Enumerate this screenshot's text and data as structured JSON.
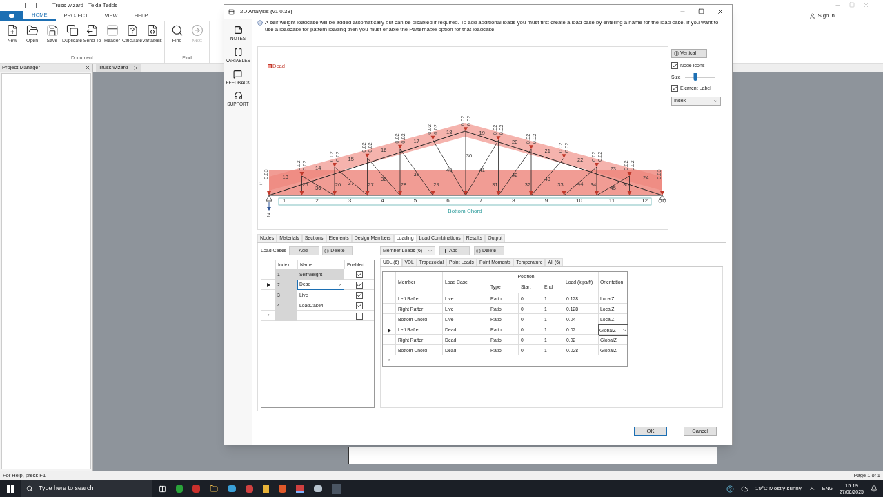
{
  "app": {
    "title": "Truss wizard - Tekla Tedds",
    "sign_in": "Sign in",
    "ribbon_tabs": [
      {
        "label": "HOME",
        "selected": true
      },
      {
        "label": "PROJECT",
        "selected": false
      },
      {
        "label": "VIEW",
        "selected": false
      },
      {
        "label": "HELP",
        "selected": false
      }
    ],
    "ribbon_groups": [
      {
        "label": "Document",
        "buttons": [
          {
            "label": "New",
            "disabled": false
          },
          {
            "label": "Open",
            "disabled": false
          },
          {
            "label": "Save",
            "disabled": false
          },
          {
            "label": "Duplicate",
            "disabled": false
          },
          {
            "label": "Send To",
            "disabled": false
          },
          {
            "label": "Header",
            "disabled": false
          },
          {
            "label": "Calculate",
            "disabled": false
          },
          {
            "label": "Variables",
            "disabled": false
          }
        ]
      },
      {
        "label": "Find",
        "buttons": [
          {
            "label": "Find",
            "disabled": false
          },
          {
            "label": "Next",
            "disabled": true
          }
        ]
      }
    ],
    "project_manager": "Project Manager",
    "document_tab": "Truss wizard",
    "status": "For Help, press F1",
    "page": "Page 1 of 1"
  },
  "dialog": {
    "title": "2D Analysis (v1.0.38)",
    "sidebar": [
      "NOTES",
      "VARIABLES",
      "FEEDBACK",
      "SUPPORT"
    ],
    "info": "A self-weight loadcase will be added automatically but can be disabled if required. To add additional loads you must first create a load case by entering a name for the load case. If you want to use a loadcase for pattern loading then you must enable the Patternable option for that loadcase.",
    "diagram": {
      "legend": "Dead",
      "support_node": "1",
      "axis": "Z",
      "bottom_chord_label": "Bottom Chord",
      "bottom_members": [
        "1",
        "2",
        "3",
        "4",
        "5",
        "6",
        "7",
        "8",
        "9",
        "10",
        "11",
        "12"
      ],
      "top_members": [
        "13",
        "14",
        "15",
        "16",
        "17",
        "18",
        "19",
        "20",
        "21",
        "22",
        "23",
        "24"
      ],
      "verticals": [
        "25",
        "26",
        "27",
        "28",
        "29",
        "30",
        "31",
        "32",
        "33",
        "34",
        "35"
      ],
      "diagonals": [
        "36",
        "37",
        "38",
        "39",
        "40",
        "41",
        "42",
        "43",
        "44",
        "45"
      ],
      "node_loads": [
        [
          "0.03"
        ],
        [
          "0.02",
          "0.02"
        ],
        [
          "0.02",
          "0.02"
        ],
        [
          "0.02",
          "0.02"
        ],
        [
          "0.02",
          "0.02"
        ],
        [
          "0.02",
          "0.02"
        ],
        [
          "0.02",
          "0.02"
        ],
        [
          "0.02",
          "0.02"
        ],
        [
          "0.02",
          "0.02"
        ],
        [
          "0.02",
          "0.02"
        ],
        [
          "0.02",
          "0.02"
        ],
        [
          "0.02",
          "0.02"
        ],
        [
          "0.03"
        ]
      ]
    },
    "options": {
      "vertical": "Vertical",
      "node_icons": {
        "label": "Node Icons",
        "checked": true
      },
      "size": {
        "label": "Size",
        "level": 0.35
      },
      "element_label": {
        "label": "Element Label",
        "checked": true
      },
      "label_type": "Index"
    },
    "tabs": [
      {
        "label": "Nodes",
        "selected": false
      },
      {
        "label": "Materials",
        "selected": false
      },
      {
        "label": "Sections",
        "selected": false
      },
      {
        "label": "Elements",
        "selected": false
      },
      {
        "label": "Design Members",
        "selected": false
      },
      {
        "label": "Loading",
        "selected": true
      },
      {
        "label": "Load Combinations",
        "selected": false
      },
      {
        "label": "Results",
        "selected": false
      },
      {
        "label": "Output",
        "selected": false
      }
    ],
    "load_cases": {
      "label": "Load Cases",
      "add": "Add",
      "delete": "Delete",
      "columns": [
        "Index",
        "Name",
        "Enabled"
      ],
      "new_row": {
        "marker": "*",
        "enabled": false
      },
      "rows": [
        {
          "index": "1",
          "name": "Self weight",
          "enabled": true,
          "current": false
        },
        {
          "index": "2",
          "name": "Dead",
          "enabled": true,
          "current": true
        },
        {
          "index": "3",
          "name": "Live",
          "enabled": true,
          "current": false
        },
        {
          "index": "4",
          "name": "LoadCase4",
          "enabled": true,
          "current": false
        }
      ]
    },
    "member_loads": {
      "selector": "Member Loads (6)",
      "add": "Add",
      "delete": "Delete",
      "tabs": [
        {
          "label": "UDL (6)",
          "selected": true
        },
        {
          "label": "VDL",
          "selected": false
        },
        {
          "label": "Trapezoidal",
          "selected": false
        },
        {
          "label": "Point Loads",
          "selected": false
        },
        {
          "label": "Point Moments",
          "selected": false
        },
        {
          "label": "Temperature",
          "selected": false
        },
        {
          "label": "All (6)",
          "selected": false
        }
      ],
      "columns": {
        "member": "Member",
        "load_case": "Load Case",
        "position": "Position",
        "type": "Type",
        "start": "Start",
        "end": "End",
        "load": "Load (kips/ft)",
        "orientation": "Orientation"
      },
      "new_row": "*",
      "rows": [
        {
          "member": "Left Rafter",
          "load_case": "Live",
          "type": "Ratio",
          "start": "0",
          "end": "1",
          "load": "0.128",
          "orientation": "LocalZ",
          "current": false
        },
        {
          "member": "Right Rafter",
          "load_case": "Live",
          "type": "Ratio",
          "start": "0",
          "end": "1",
          "load": "0.128",
          "orientation": "LocalZ",
          "current": false
        },
        {
          "member": "Bottom Chord",
          "load_case": "Live",
          "type": "Ratio",
          "start": "0",
          "end": "1",
          "load": "0.04",
          "orientation": "LocalZ",
          "current": false
        },
        {
          "member": "Left Rafter",
          "load_case": "Dead",
          "type": "Ratio",
          "start": "0",
          "end": "1",
          "load": "0.02",
          "orientation": "GlobalZ",
          "current": true
        },
        {
          "member": "Right Rafter",
          "load_case": "Dead",
          "type": "Ratio",
          "start": "0",
          "end": "1",
          "load": "0.02",
          "orientation": "GlobalZ",
          "current": false
        },
        {
          "member": "Bottom Chord",
          "load_case": "Dead",
          "type": "Ratio",
          "start": "0",
          "end": "1",
          "load": "0.028",
          "orientation": "GlobalZ",
          "current": false
        }
      ]
    },
    "ok": "OK",
    "cancel": "Cancel"
  },
  "taskbar": {
    "search": "Type here to search",
    "weather": "19°C  Mostly sunny",
    "lang": "ENG",
    "time": "15:19",
    "date": "27/06/2025"
  }
}
